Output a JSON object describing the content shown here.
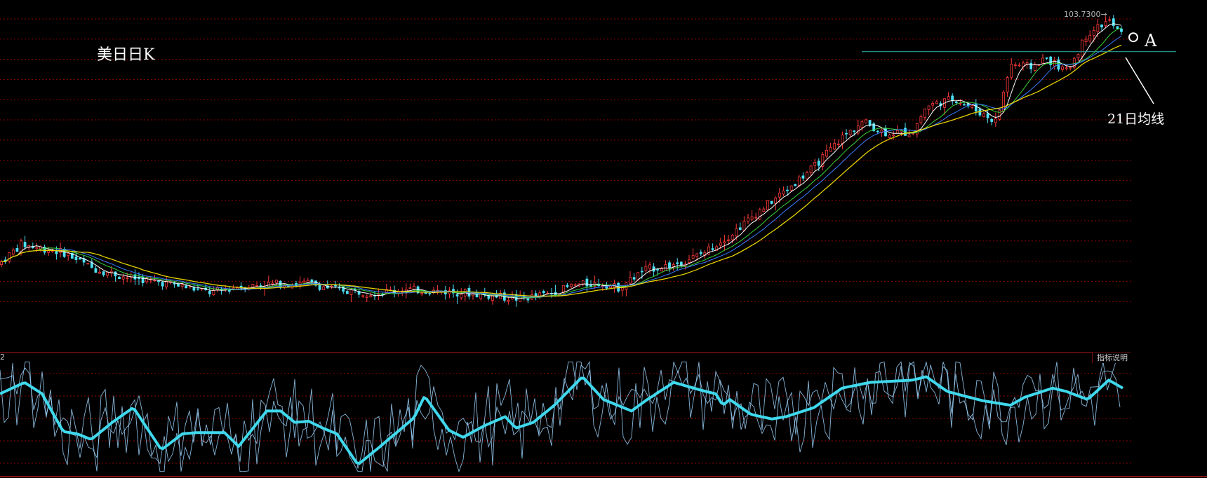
{
  "title": "美日日K",
  "annotations": {
    "point_label": "A",
    "ma_label": "21日均线"
  },
  "price_label": "103.7300",
  "sub_panel": {
    "button_label": "指标说明",
    "left_number": "2"
  },
  "colors": {
    "background": "#000000",
    "grid": "#8b0000",
    "up": "#ff3b3b",
    "down": "#4de0f5",
    "ma_white": "#ffffff",
    "ma_yellow": "#e6d200",
    "ma_green": "#39d339",
    "ma_blue": "#3a7bff",
    "oscillator_main": "#3fd8ec",
    "oscillator_thin": "#9fd6ff",
    "support_line": "#2aa198"
  },
  "chart_data": [
    {
      "type": "candlestick",
      "title": "美日日K",
      "y_range": [
        85.0,
        104.2
      ],
      "max_price_label": 103.73,
      "horizontal_level": 101.6,
      "ohlc_anchors": [
        [
          0,
          88.0
        ],
        [
          30,
          89.2
        ],
        [
          55,
          89.0
        ],
        [
          90,
          88.7
        ],
        [
          130,
          87.7
        ],
        [
          180,
          87.1
        ],
        [
          240,
          86.7
        ],
        [
          300,
          86.1
        ],
        [
          340,
          86.5
        ],
        [
          400,
          86.7
        ],
        [
          440,
          86.7
        ],
        [
          480,
          86.3
        ],
        [
          530,
          86.1
        ],
        [
          580,
          86.3
        ],
        [
          620,
          86.2
        ],
        [
          660,
          86.1
        ],
        [
          700,
          85.9
        ],
        [
          740,
          85.7
        ],
        [
          780,
          86.0
        ],
        [
          820,
          86.6
        ],
        [
          860,
          86.7
        ],
        [
          880,
          86.4
        ],
        [
          920,
          87.6
        ],
        [
          960,
          87.9
        ],
        [
          1000,
          88.6
        ],
        [
          1040,
          89.8
        ],
        [
          1080,
          91.3
        ],
        [
          1120,
          92.7
        ],
        [
          1160,
          94.2
        ],
        [
          1200,
          96.1
        ],
        [
          1230,
          97.1
        ],
        [
          1260,
          96.4
        ],
        [
          1300,
          96.4
        ],
        [
          1320,
          98.1
        ],
        [
          1360,
          98.6
        ],
        [
          1400,
          97.6
        ],
        [
          1420,
          97.1
        ],
        [
          1440,
          100.8
        ],
        [
          1470,
          100.6
        ],
        [
          1490,
          101.2
        ],
        [
          1520,
          100.3
        ],
        [
          1550,
          102.8
        ],
        [
          1580,
          103.6
        ],
        [
          1600,
          102.6
        ]
      ],
      "moving_averages": [
        {
          "name": "MA5",
          "color": "white",
          "period": 5
        },
        {
          "name": "MA10",
          "color": "green",
          "period": 10
        },
        {
          "name": "MA14",
          "color": "blue",
          "period": 14
        },
        {
          "name": "MA21",
          "color": "yellow",
          "period": 21
        }
      ]
    },
    {
      "type": "line",
      "title": "",
      "y_range": [
        0,
        100
      ],
      "main_series_anchors": [
        [
          0,
          70
        ],
        [
          35,
          80
        ],
        [
          60,
          70
        ],
        [
          90,
          37
        ],
        [
          110,
          35
        ],
        [
          130,
          30
        ],
        [
          160,
          45
        ],
        [
          190,
          58
        ],
        [
          230,
          21
        ],
        [
          260,
          35
        ],
        [
          280,
          36
        ],
        [
          320,
          36
        ],
        [
          340,
          24
        ],
        [
          380,
          55
        ],
        [
          400,
          55
        ],
        [
          420,
          45
        ],
        [
          440,
          46
        ],
        [
          460,
          40
        ],
        [
          480,
          35
        ],
        [
          510,
          8
        ],
        [
          540,
          23
        ],
        [
          590,
          49
        ],
        [
          605,
          68
        ],
        [
          640,
          38
        ],
        [
          660,
          32
        ],
        [
          690,
          42
        ],
        [
          720,
          50
        ],
        [
          735,
          40
        ],
        [
          760,
          45
        ],
        [
          790,
          60
        ],
        [
          830,
          85
        ],
        [
          860,
          65
        ],
        [
          880,
          60
        ],
        [
          900,
          55
        ],
        [
          920,
          64
        ],
        [
          960,
          80
        ],
        [
          1000,
          73
        ],
        [
          1020,
          70
        ],
        [
          1030,
          60
        ],
        [
          1040,
          65
        ],
        [
          1070,
          52
        ],
        [
          1100,
          48
        ],
        [
          1120,
          50
        ],
        [
          1160,
          58
        ],
        [
          1200,
          75
        ],
        [
          1240,
          80
        ],
        [
          1300,
          82
        ],
        [
          1320,
          85
        ],
        [
          1350,
          72
        ],
        [
          1400,
          64
        ],
        [
          1440,
          60
        ],
        [
          1460,
          67
        ],
        [
          1500,
          75
        ],
        [
          1520,
          72
        ],
        [
          1550,
          65
        ],
        [
          1580,
          82
        ],
        [
          1600,
          75
        ],
        [
          1640,
          85
        ],
        [
          1680,
          68
        ],
        [
          1720,
          60
        ]
      ]
    }
  ]
}
